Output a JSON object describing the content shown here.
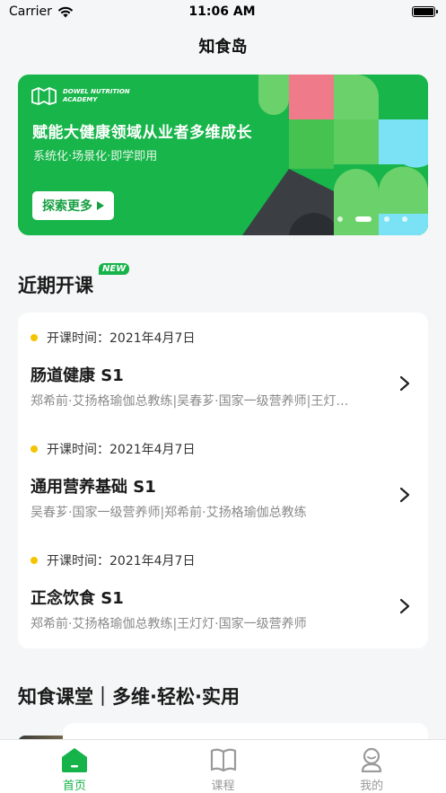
{
  "status_bar": {
    "carrier": "Carrier",
    "time": "11:06 AM",
    "battery_level": 1.0
  },
  "nav": {
    "title": "知食岛"
  },
  "banner": {
    "logo_line1": "DOWEL NUTRITION",
    "logo_line2": "ACADEMY",
    "title": "赋能大健康领域从业者多维成长",
    "subtitle": "系统化·场景化·即学即用",
    "button_label": "探索更多",
    "active_slide": 1,
    "slide_count": 4
  },
  "upcoming": {
    "title": "近期开课",
    "badge": "NEW",
    "courses": [
      {
        "time": "开课时间：2021年4月7日",
        "name": "肠道健康 S1",
        "teachers": "郑希前·艾扬格瑜伽总教练|吴春芗·国家一级营养师|王灯…"
      },
      {
        "time": "开课时间：2021年4月7日",
        "name": "通用营养基础 S1",
        "teachers": "吴春芗·国家一级营养师|郑希前·艾扬格瑜伽总教练"
      },
      {
        "time": "开课时间：2021年4月7日",
        "name": "正念饮食 S1",
        "teachers": "郑希前·艾扬格瑜伽总教练|王灯灯·国家一级营养师"
      }
    ]
  },
  "classroom": {
    "title": "知食课堂｜多维·轻松·实用"
  },
  "tabs": [
    {
      "label": "首页",
      "icon": "home-icon",
      "active": true
    },
    {
      "label": "课程",
      "icon": "book-icon",
      "active": false
    },
    {
      "label": "我的",
      "icon": "profile-icon",
      "active": false
    }
  ],
  "colors": {
    "brand_green": "#16b34a",
    "accent_yellow": "#f5c400",
    "background": "#f5f6f7"
  }
}
